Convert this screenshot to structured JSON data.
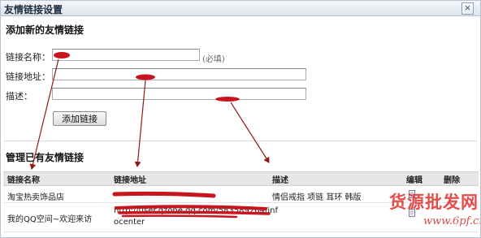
{
  "dialog": {
    "title": "友情链接设置",
    "close_label": "×"
  },
  "add_section": {
    "heading": "添加新的友情链接",
    "name_label": "链接名称：",
    "name_value": "",
    "required_hint": "(必填)",
    "url_label": "链接地址：",
    "url_value": "",
    "desc_label": "描述：",
    "desc_value": "",
    "submit_label": "添加链接"
  },
  "manage_section": {
    "heading": "管理已有友情链接",
    "columns": {
      "name": "链接名称",
      "url": "链接地址",
      "description": "描述",
      "edit": "编辑",
      "delete": "删除"
    },
    "rows": [
      {
        "name": "淘宝热卖饰品店",
        "description": "情侣戒指  项链  耳环  韩版"
      },
      {
        "name": "我的QQ空间~欢迎来访",
        "url_line1": "http://user.qzone.qq.com/583589264/inf",
        "url_line2": "ocenter"
      }
    ]
  },
  "icons": {
    "close": "close-icon",
    "edit": "edit-icon"
  },
  "watermark": {
    "text": "货源批发网",
    "url": "www.6pf.cn"
  },
  "colors": {
    "titlebar": "#dde4ec",
    "table_header": "#e6e6e6",
    "annotation_red": "#c8141c",
    "watermark_red": "#e23a36"
  }
}
